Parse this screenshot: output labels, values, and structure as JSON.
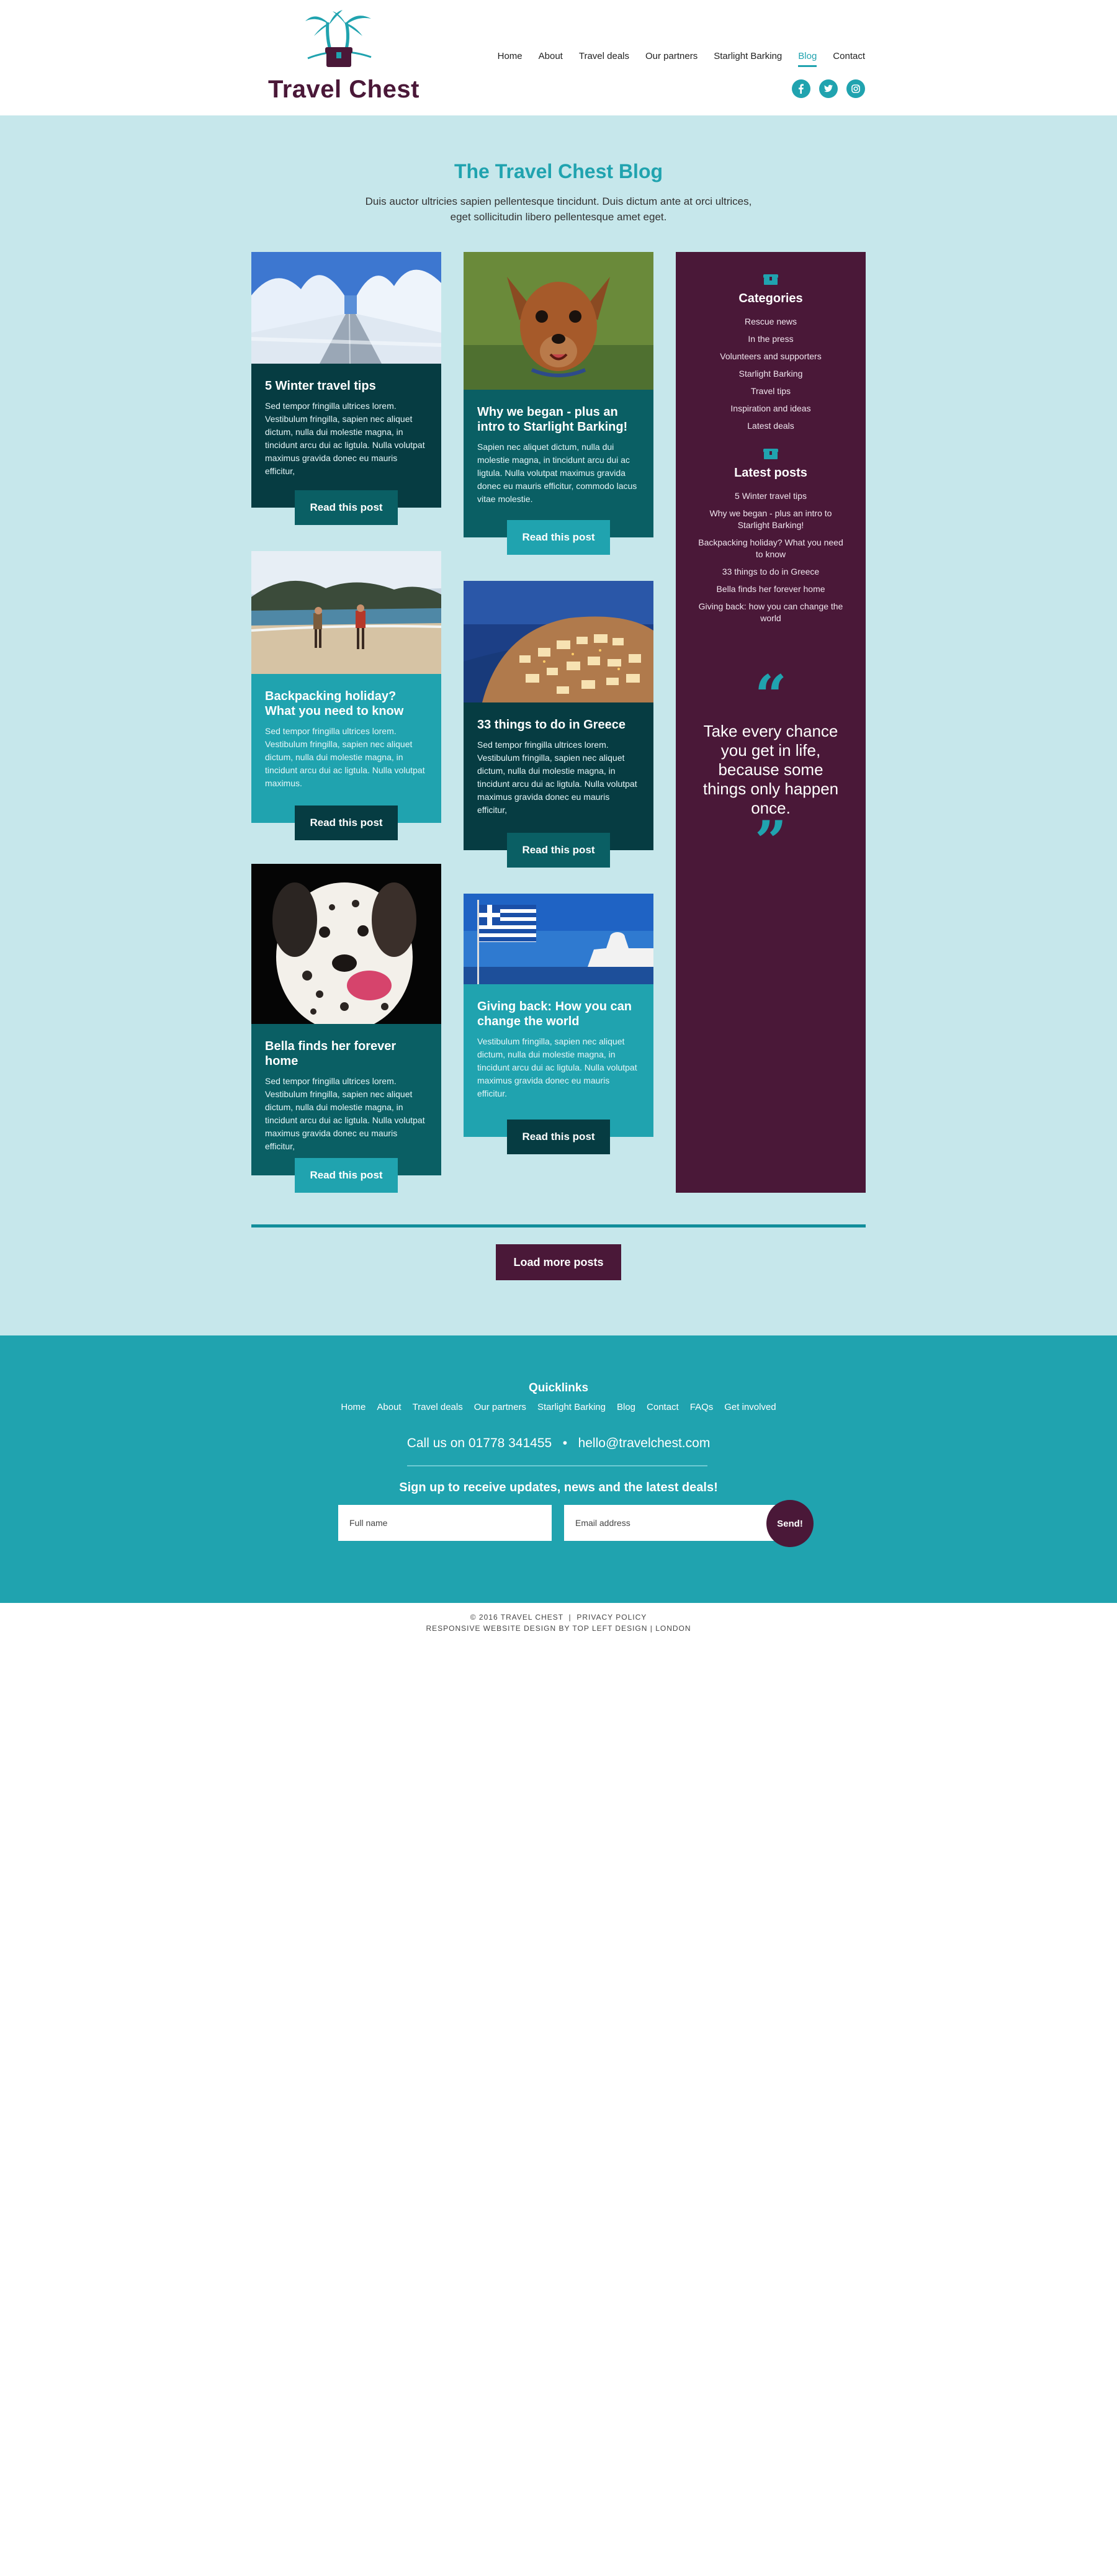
{
  "header": {
    "logo_text": "Travel Chest",
    "nav": [
      {
        "label": "Home",
        "active": false
      },
      {
        "label": "About",
        "active": false
      },
      {
        "label": "Travel deals",
        "active": false
      },
      {
        "label": "Our partners",
        "active": false
      },
      {
        "label": "Starlight Barking",
        "active": false
      },
      {
        "label": "Blog",
        "active": true
      },
      {
        "label": "Contact",
        "active": false
      }
    ],
    "social": [
      "facebook-icon",
      "twitter-icon",
      "instagram-icon"
    ]
  },
  "main": {
    "title": "The Travel Chest Blog",
    "intro": "Duis auctor ultricies sapien pellentesque tincidunt. Duis dictum ante at orci ultrices, eget sollicitudin libero pellentesque amet eget.",
    "read_label": "Read this post",
    "posts": [
      {
        "title": "5 Winter travel tips",
        "excerpt": "Sed tempor fringilla ultrices lorem. Vestibulum fringilla, sapien nec aliquet dictum, nulla dui molestie magna, in tincidunt arcu dui ac ligtula. Nulla volutpat maximus gravida donec eu mauris efficitur,",
        "image": "snowy-road"
      },
      {
        "title": "Why we began - plus an intro to Starlight Barking!",
        "excerpt": "Sapien nec aliquet dictum, nulla dui molestie magna, in tincidunt arcu dui ac ligtula. Nulla volutpat maximus gravida donec eu mauris efficitur, commodo lacus vitae molestie.",
        "image": "small-dog"
      },
      {
        "title": "Backpacking holiday? What you need to know",
        "excerpt": "Sed tempor fringilla ultrices lorem. Vestibulum fringilla, sapien nec aliquet dictum, nulla dui molestie magna, in tincidunt arcu dui ac ligtula. Nulla volutpat maximus.",
        "image": "beach-hikers"
      },
      {
        "title": "33 things to do in Greece",
        "excerpt": "Sed tempor fringilla ultrices lorem. Vestibulum fringilla, sapien nec aliquet dictum, nulla dui molestie magna, in tincidunt arcu dui ac ligtula. Nulla volutpat maximus gravida donec eu mauris efficitur,",
        "image": "santorini"
      },
      {
        "title": "Bella finds her forever home",
        "excerpt": "Sed tempor fringilla ultrices lorem. Vestibulum fringilla, sapien nec aliquet dictum, nulla dui molestie magna, in tincidunt arcu dui ac ligtula. Nulla volutpat maximus gravida donec eu mauris efficitur,",
        "image": "dalmatian"
      },
      {
        "title": "Giving back: How you can change the world",
        "excerpt": "Vestibulum fringilla, sapien nec aliquet dictum, nulla dui molestie magna, in tincidunt arcu dui ac ligtula. Nulla volutpat maximus gravida donec eu mauris efficitur.",
        "image": "greek-flag"
      }
    ],
    "load_more": "Load more posts"
  },
  "sidebar": {
    "categories_title": "Categories",
    "categories": [
      "Rescue news",
      "In the press",
      "Volunteers and supporters",
      "Starlight Barking",
      "Travel tips",
      "Inspiration and ideas",
      "Latest deals"
    ],
    "latest_title": "Latest posts",
    "latest": [
      "5 Winter travel tips",
      "Why we began - plus an intro to Starlight Barking!",
      "Backpacking holiday? What you need to know",
      "33 things to do in Greece",
      "Bella finds her forever home",
      "Giving back: how you can change the world"
    ],
    "quote_open": "“",
    "quote": "Take every chance you get in life, because some things only happen once.",
    "quote_close": "”"
  },
  "footer": {
    "quicklinks_title": "Quicklinks",
    "quicklinks": [
      "Home",
      "About",
      "Travel deals",
      "Our partners",
      "Starlight Barking",
      "Blog",
      "Contact",
      "FAQs",
      "Get involved"
    ],
    "contact": "Call us on 01778 341455   •   hello@travelchest.com",
    "signup_title": "Sign up to receive updates, news and the latest deals!",
    "name_placeholder": "Full name",
    "email_placeholder": "Email address",
    "send_label": "Send!"
  },
  "copyright": {
    "line1": "© 2016 TRAVEL CHEST  |  PRIVACY POLICY",
    "line2": "RESPONSIVE WEBSITE DESIGN BY TOP LEFT DESIGN | LONDON"
  },
  "colors": {
    "teal": "#20a3af",
    "plum": "#4a1838",
    "dark_teal": "#0a5f64",
    "deep_teal": "#063c42",
    "page_bg": "#c6e7eb"
  }
}
